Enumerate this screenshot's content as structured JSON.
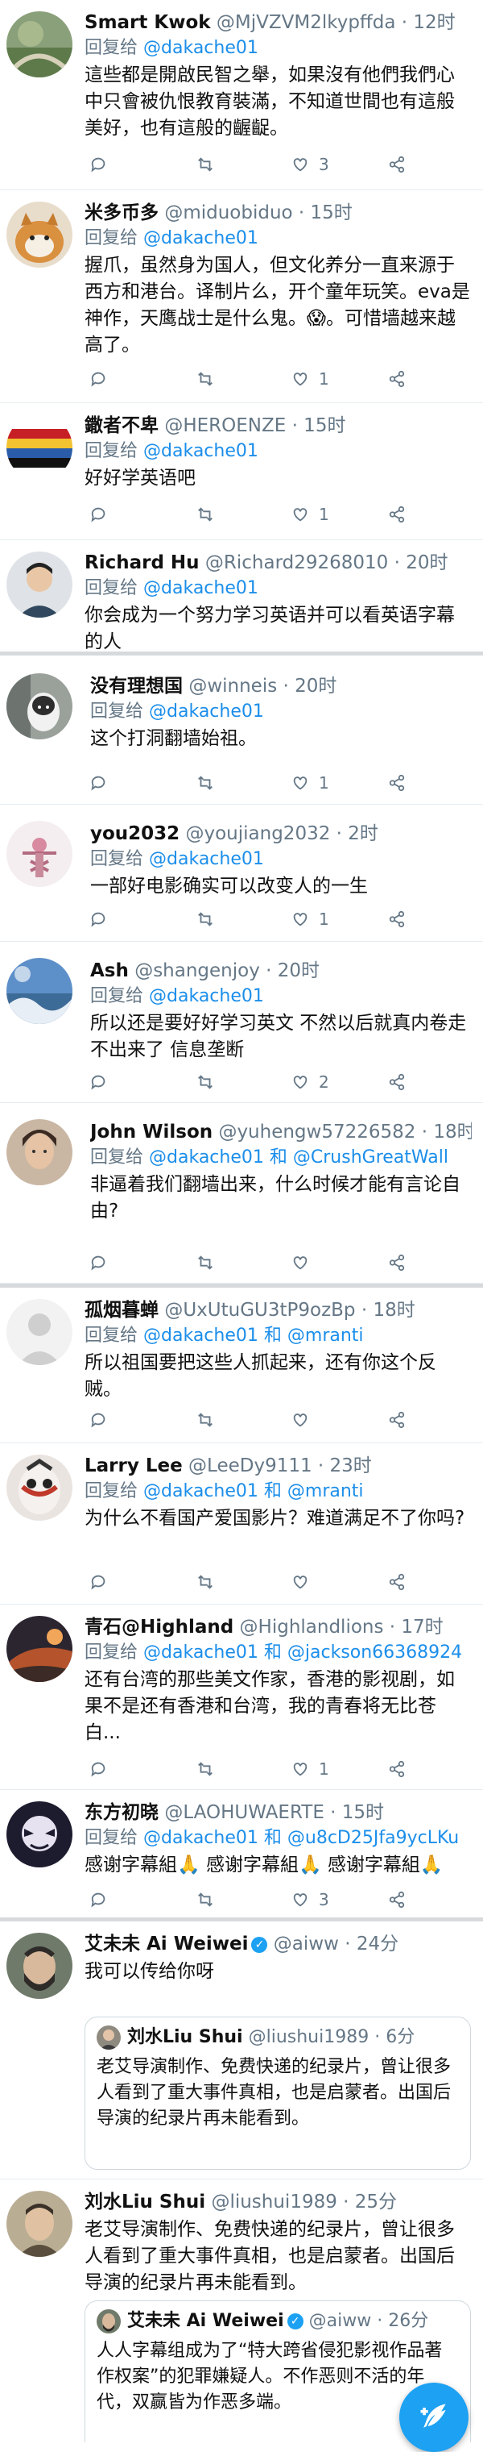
{
  "reply_prefix": "回复给",
  "and_word": "和",
  "colors": {
    "link": "#1b8eea",
    "muted": "#657786",
    "accent": "#1da1f2"
  },
  "tweets": [
    {
      "name": "Smart Kwok",
      "handle": "@MjVZVM2lkypffda",
      "time": "· 12时",
      "reply_to": [
        "@dakache01"
      ],
      "text": "這些都是開啟民智之舉，如果沒有他們我們心中只會被仇恨教育裝滿，不知道世間也有這般美好，也有這般的齷齪。",
      "counts": {
        "reply": "",
        "retweet": "",
        "like": "3"
      }
    },
    {
      "name": "米多币多",
      "handle": "@miduobiduo",
      "time": "· 15时",
      "reply_to": [
        "@dakache01"
      ],
      "text": "握爪，虽然身为国人，但文化养分一直来源于西方和港台。译制片么，开个童年玩笑。eva是神作，天鹰战士是什么鬼。😱。可惜墙越来越高了。",
      "counts": {
        "reply": "",
        "retweet": "",
        "like": "1"
      }
    },
    {
      "name": "鏾者不卑",
      "handle": "@HEROENZE",
      "time": "· 15时",
      "reply_to": [
        "@dakache01"
      ],
      "text": "好好学英语吧",
      "counts": {
        "reply": "",
        "retweet": "",
        "like": "1"
      }
    },
    {
      "name": "Richard Hu",
      "handle": "@Richard29268010",
      "time": "· 20时",
      "reply_to": [
        "@dakache01"
      ],
      "text": "你会成为一个努力学习英语并可以看英语字幕的人",
      "counts": {
        "reply": "",
        "retweet": "",
        "like": ""
      }
    },
    {
      "name": "没有理想国",
      "handle": "@winneis",
      "time": "· 20时",
      "reply_to": [
        "@dakache01"
      ],
      "text": "这个打洞翻墙始祖。",
      "counts": {
        "reply": "",
        "retweet": "",
        "like": "1"
      }
    },
    {
      "name": "you2032",
      "handle": "@youjiang2032",
      "time": "· 2时",
      "reply_to": [
        "@dakache01"
      ],
      "text": "一部好电影确实可以改变人的一生",
      "counts": {
        "reply": "",
        "retweet": "",
        "like": "1"
      }
    },
    {
      "name": "Ash",
      "handle": "@shangenjoy",
      "time": "· 20时",
      "reply_to": [
        "@dakache01"
      ],
      "text": "所以还是要好好学习英文 不然以后就真内卷走不出来了 信息垄断",
      "counts": {
        "reply": "",
        "retweet": "",
        "like": "2"
      }
    },
    {
      "name": "John Wilson",
      "handle": "@yuhengw57226582",
      "time": "· 18时",
      "reply_to": [
        "@dakache01",
        "@CrushGreatWall"
      ],
      "text": "非逼着我们翻墙出来，什么时候才能有言论自由?",
      "counts": {
        "reply": "",
        "retweet": "",
        "like": ""
      }
    },
    {
      "name": "孤烟暮蝉",
      "handle": "@UxUtuGU3tP9ozBp",
      "time": "· 18时",
      "reply_to": [
        "@dakache01",
        "@mranti"
      ],
      "text": "所以祖国要把这些人抓起来，还有你这个反贼。",
      "counts": {
        "reply": "",
        "retweet": "",
        "like": ""
      }
    },
    {
      "name": "Larry Lee",
      "handle": "@LeeDy9111",
      "time": "· 23时",
      "reply_to": [
        "@dakache01",
        "@mranti"
      ],
      "text": "为什么不看国产爱国影片？难道满足不了你吗?",
      "counts": {
        "reply": "",
        "retweet": "",
        "like": ""
      }
    },
    {
      "name": "青石@Highland",
      "handle": "@Highlandlions",
      "time": "· 17时",
      "reply_to": [
        "@dakache01",
        "@jackson66368924"
      ],
      "text": "还有台湾的那些美文作家，香港的影视剧，如果不是还有香港和台湾，我的青春将无比苍白...",
      "counts": {
        "reply": "",
        "retweet": "",
        "like": "1"
      }
    },
    {
      "name": "东方初晓",
      "handle": "@LAOHUWAERTE",
      "time": "· 15时",
      "reply_to": [
        "@dakache01",
        "@u8cD25Jfa9ycLKu"
      ],
      "text": "感谢字幕組🙏 感谢字幕組🙏 感谢字幕組🙏",
      "counts": {
        "reply": "",
        "retweet": "",
        "like": "3"
      }
    }
  ],
  "quote_tweets": [
    {
      "name": "艾未未 Ai Weiwei",
      "handle": "@aiww",
      "time": "· 24分",
      "text": "我可以传给你呀",
      "quote": {
        "name": "刘水Liu Shui",
        "handle": "@liushui1989",
        "time": "· 6分",
        "text": "老艾导演制作、免费快递的纪录片，曾让很多人看到了重大事件真相，也是启蒙者。出国后导演的纪录片再未能看到。"
      }
    },
    {
      "name": "刘水Liu Shui",
      "handle": "@liushui1989",
      "time": "· 25分",
      "text": "老艾导演制作、免费快递的纪录片，曾让很多人看到了重大事件真相，也是启蒙者。出国后导演的纪录片再未能看到。",
      "quote": {
        "name": "艾未未 Ai Weiwei",
        "handle": "@aiww",
        "time": "· 26分",
        "text": "人人字幕组成为了“特大跨省侵犯影视作品著作权案”的犯罪嫌疑人。不作恶则不活的年代，双赢皆为作恶多端。"
      }
    }
  ]
}
